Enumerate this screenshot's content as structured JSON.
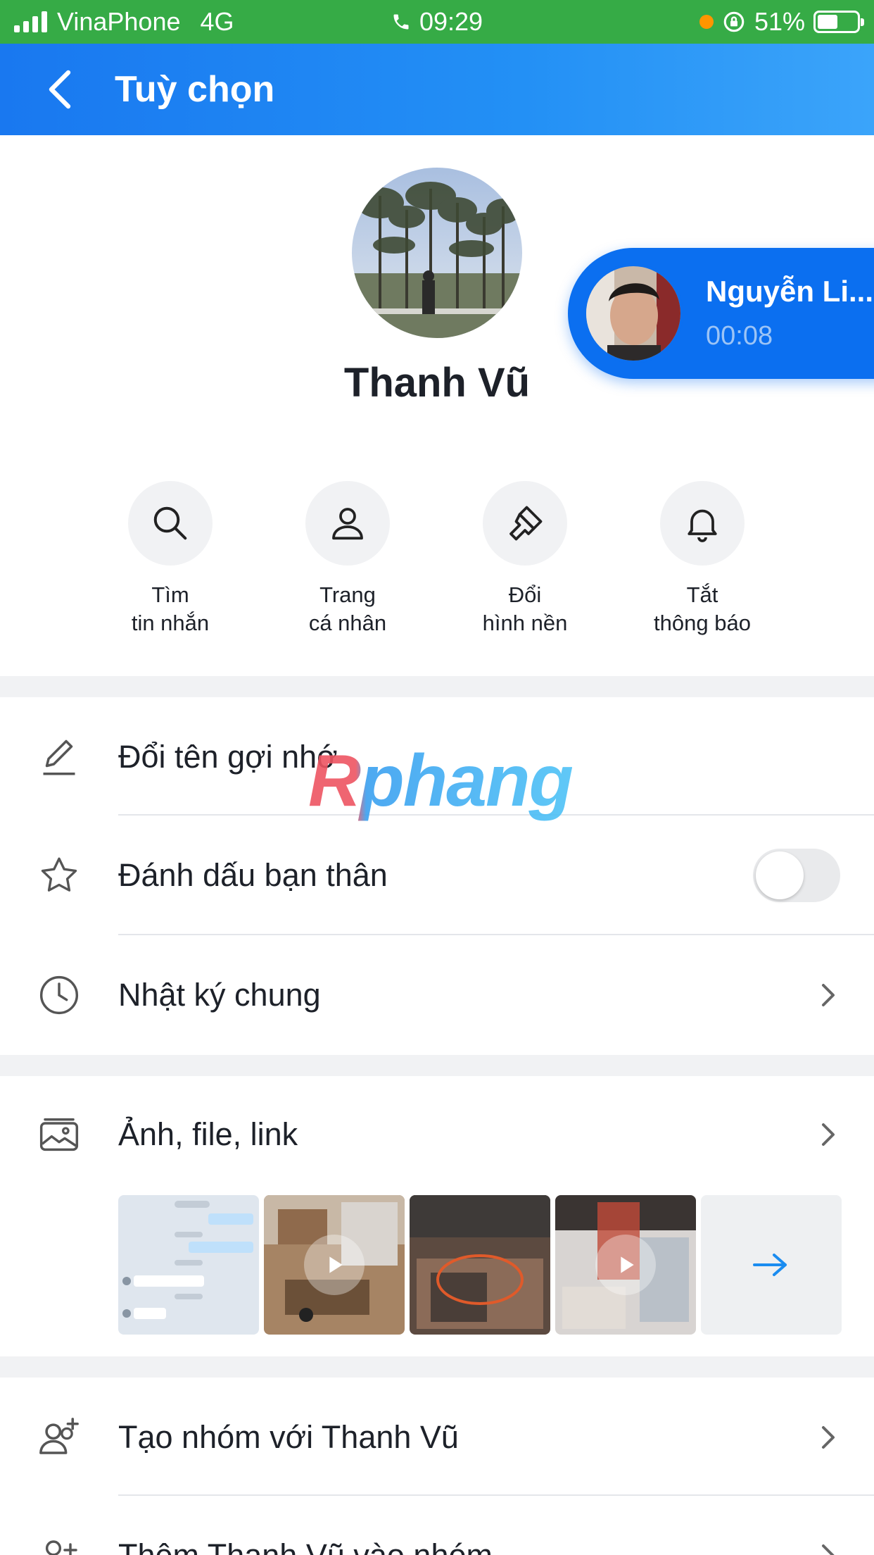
{
  "status_bar": {
    "carrier": "VinaPhone",
    "network": "4G",
    "time": "09:29",
    "battery": "51%",
    "battery_level": 0.51
  },
  "header": {
    "title": "Tuỳ chọn"
  },
  "profile": {
    "name": "Thanh Vũ"
  },
  "call_bubble": {
    "name": "Nguyễn Li...",
    "duration": "00:08"
  },
  "actions": [
    {
      "icon": "search-icon",
      "line1": "Tìm",
      "line2": "tin nhắn"
    },
    {
      "icon": "user-icon",
      "line1": "Trang",
      "line2": "cá nhân"
    },
    {
      "icon": "paint-brush-icon",
      "line1": "Đổi",
      "line2": "hình nền"
    },
    {
      "icon": "bell-icon",
      "line1": "Tắt",
      "line2": "thông báo"
    }
  ],
  "rows": {
    "rename": "Đổi tên gợi nhớ",
    "best_friend": "Đánh dấu bạn thân",
    "best_friend_on": false,
    "shared_diary": "Nhật ký chung",
    "media": "Ảnh, file, link",
    "create_group": "Tạo nhóm với Thanh Vũ",
    "add_to_group": "Thêm Thanh Vũ vào nhóm"
  },
  "watermark": "Rphang",
  "colors": {
    "status_bar": "#36ab46",
    "header_start": "#1978f0",
    "header_end": "#3ba4fa",
    "call_bubble": "#0b6ff0",
    "section_gap": "#f1f2f4"
  }
}
